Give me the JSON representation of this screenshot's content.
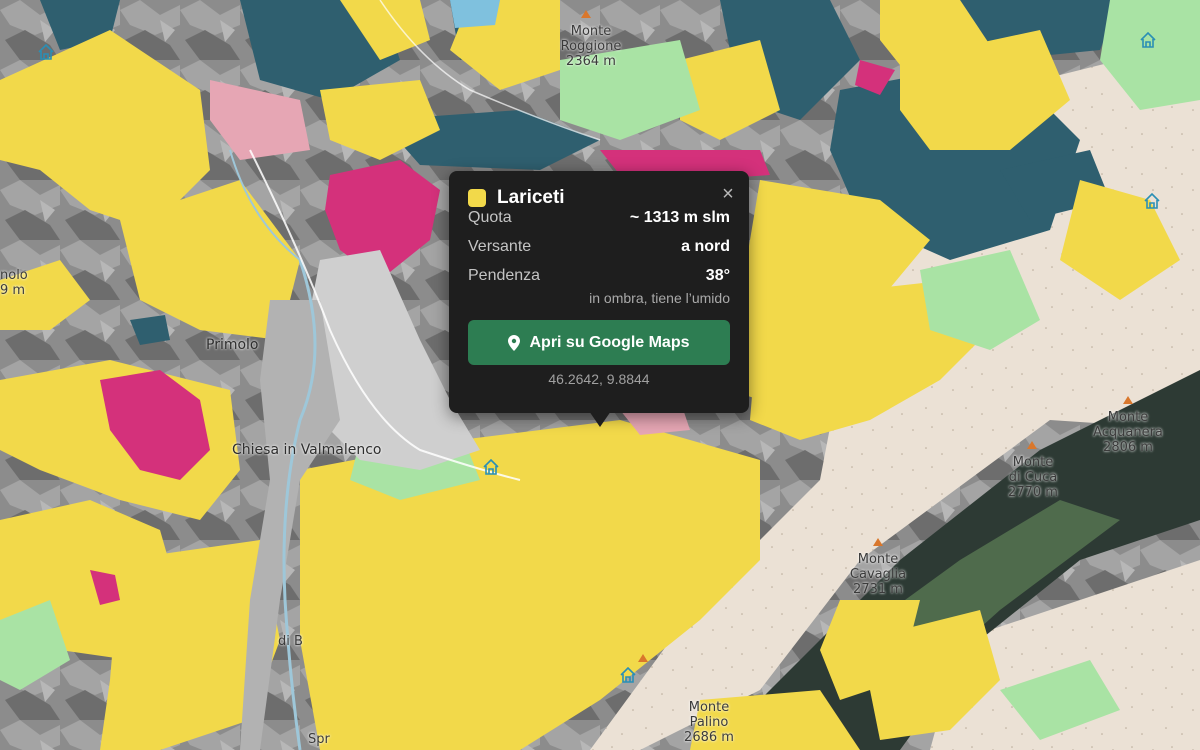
{
  "popup": {
    "title": "Lariceti",
    "swatch_color": "#f2d94a",
    "close_icon": "close-icon",
    "rows": [
      {
        "label": "Quota",
        "value": "~ 1313 m slm"
      },
      {
        "label": "Versante",
        "value": "a nord"
      },
      {
        "label": "Pendenza",
        "value": "38°"
      }
    ],
    "note": "in ombra, tiene l’umido",
    "button_label": "Apri su Google Maps",
    "button_icon": "map-pin-icon",
    "button_color": "#2d7d52",
    "coordinates": "46.2642, 9.8844"
  },
  "map": {
    "legend_colors": {
      "larch": "#f2d94a",
      "spruce": "#2f5f6f",
      "broadleaf": "#a9e3a4",
      "pine": "#d4317b",
      "rock": "#8b8b8b",
      "scree": "#ecdcc8"
    },
    "labels": {
      "monte_roggione": "Monte\nRoggione\n2364 m",
      "primolo": "Primolo",
      "chiesa": "Chiesa in Valmalenco",
      "monte_acquanera": "Monte\nAcquanera\n2806 m",
      "monte_di_cuca": "Monte\ndi Cuca\n2770 m",
      "monte_cavaglia": "Monte\nCavaglia\n2731 m",
      "monte_palino": "Monte\nPalino\n2686 m",
      "left_edge": "nolo\n9 m",
      "caspoggio": "di B",
      "bottom": "Spr"
    },
    "poi_icons": [
      "hut-icon",
      "hut-icon",
      "hut-icon",
      "hut-icon",
      "hut-icon"
    ]
  }
}
